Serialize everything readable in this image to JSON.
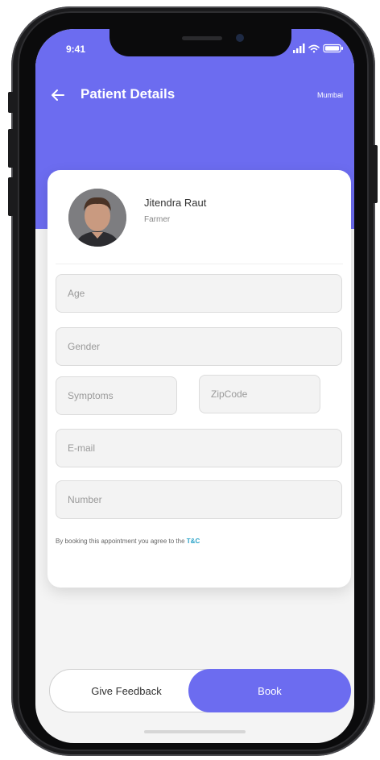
{
  "status_bar": {
    "time": "9:41"
  },
  "header": {
    "title": "Patient Details",
    "location": "Mumbai"
  },
  "profile": {
    "name": "Jitendra Raut",
    "role": "Farmer"
  },
  "form": {
    "age_placeholder": "Age",
    "gender_placeholder": "Gender",
    "symptoms_placeholder": "Symptoms",
    "zipcode_placeholder": "ZipCode",
    "email_placeholder": "E-mail",
    "number_placeholder": "Number"
  },
  "terms": {
    "text": "By booking this appointment you agree to the ",
    "link": "T&C"
  },
  "actions": {
    "feedback_label": "Give Feedback",
    "book_label": "Book"
  },
  "colors": {
    "primary": "#6c6cf0",
    "link": "#2aa3c8"
  }
}
